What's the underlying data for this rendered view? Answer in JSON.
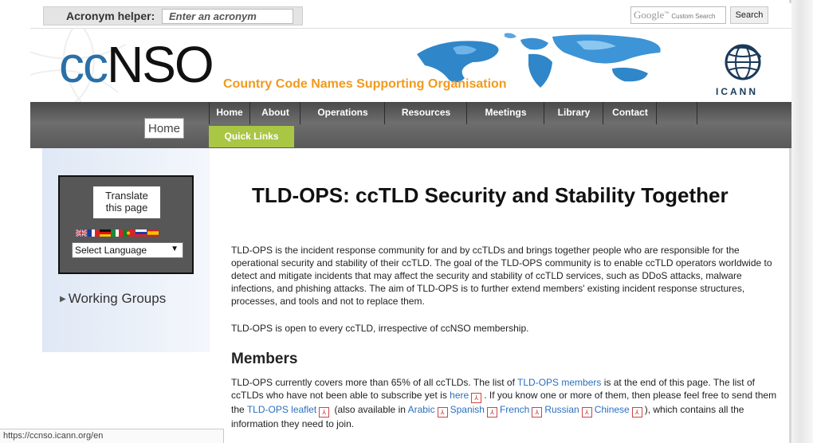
{
  "topbar": {
    "acronym_label": "Acronym helper:",
    "acronym_placeholder": "Enter an acronym",
    "google_brand": "Google",
    "google_tag": "Custom Search",
    "search_button": "Search"
  },
  "header": {
    "logo_cc": "cc",
    "logo_nso": "NSO",
    "tagline": "Country Code Names Supporting Organisation",
    "icann": "ICANN"
  },
  "nav": {
    "breadcrumb": "Home",
    "items": [
      "Home",
      "About",
      "Operations",
      "Resources",
      "Meetings",
      "Library",
      "Contact"
    ],
    "quick_links": "Quick Links"
  },
  "sidebar": {
    "translate_line1": "Translate",
    "translate_line2": "this page",
    "language_select": "Select Language",
    "working_groups": "Working Groups"
  },
  "content": {
    "title": "TLD-OPS: ccTLD Security and Stability Together",
    "p1": "TLD-OPS is the incident response community for and by ccTLDs and brings together people who are responsible for the operational security and stability of their ccTLD. The goal of the TLD-OPS community is to enable ccTLD operators worldwide to detect and mitigate incidents that may affect the security and stability of ccTLD services, such as DDoS attacks, malware infections, and phishing attacks. The aim of TLD-OPS is to further extend members' existing incident response structures, processes, and tools and not to replace them.",
    "p2": "TLD-OPS is open to every ccTLD, irrespective of ccNSO membership.",
    "members_heading": "Members",
    "m_a": "TLD-OPS currently covers more than 65% of all ccTLDs. The list of ",
    "m_link1": "TLD-OPS members",
    "m_b": " is at the end of this page. The list of ccTLDs who have not been able to subscribe yet is ",
    "m_link2": "here",
    "m_c": ". If you know one or more of them, then please feel free to send them the ",
    "m_link3": "TLD-OPS leaflet",
    "m_d": " (also available in ",
    "m_arabic": "Arabic",
    "m_spanish": "Spanish",
    "m_french": "French",
    "m_russian": "Russian",
    "m_chinese": "Chinese",
    "m_e": "), which contains all the information they need to join."
  },
  "statusbar": {
    "url": "https://ccnso.icann.org/en"
  },
  "colors": {
    "accent_orange": "#f19a1d",
    "link_blue": "#2a6fc0",
    "quick_links_green": "#a9c645",
    "nav_gray": "#595959"
  }
}
